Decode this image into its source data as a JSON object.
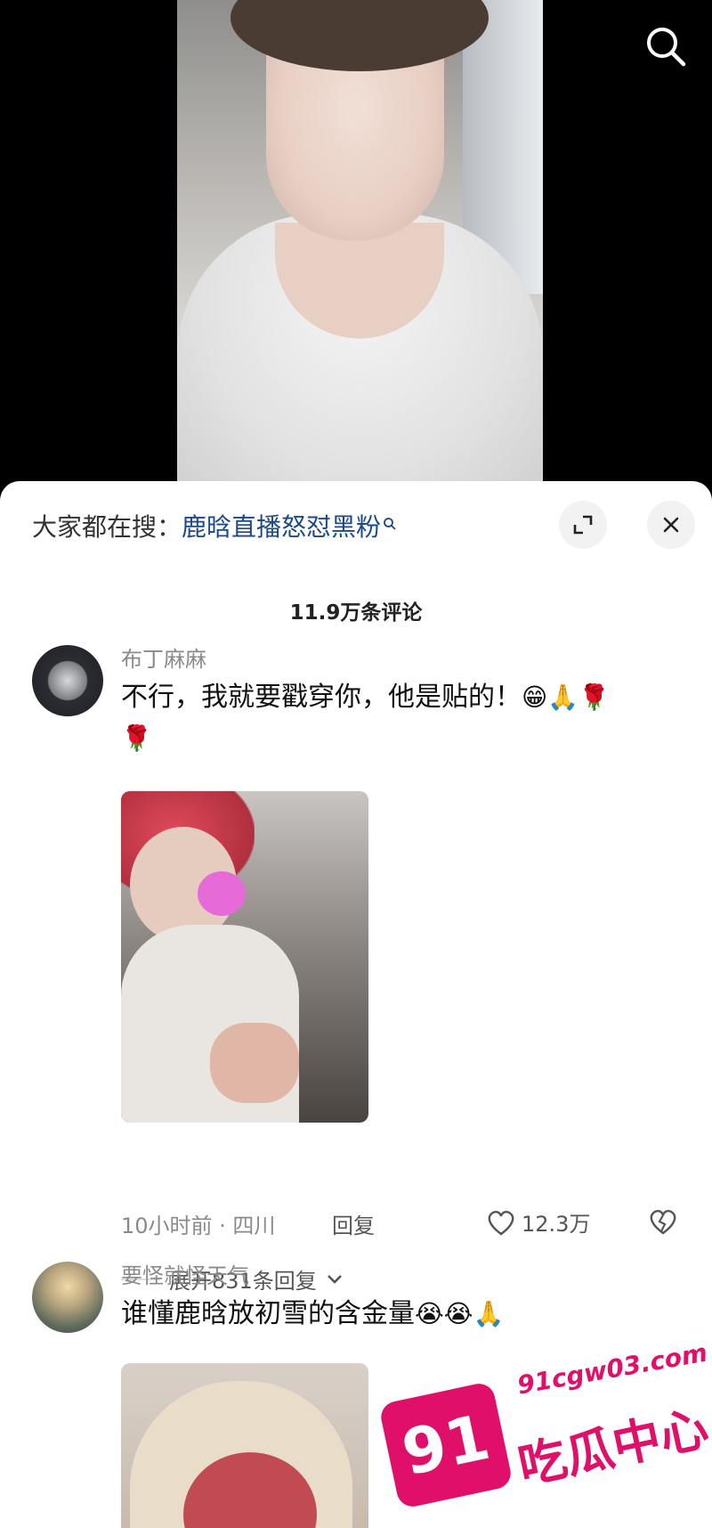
{
  "search_hint": {
    "prefix": "大家都在搜：",
    "keyword": "鹿晗直播怒怼黑粉"
  },
  "comments_count": "11.9万条评论",
  "comments": [
    {
      "username": "布丁麻麻",
      "text": "不行，我就要戳穿你，他是贴的！",
      "emojis": [
        "😁",
        "🙏",
        "🌹",
        "🌹"
      ],
      "time_location": "10小时前 · 四川",
      "reply_label": "回复",
      "likes": "12.3万",
      "expand_label": "展开831条回复"
    },
    {
      "username": "要怪就怪天气",
      "text": "谁懂鹿晗放初雪的含金量",
      "emojis": [
        "😭",
        "😭",
        "🙏"
      ]
    }
  ],
  "watermark": {
    "number": "91",
    "url": "91cgw03.com",
    "name": "吃瓜中心"
  },
  "colors": {
    "keyword": "#1a4a8c",
    "watermark": "#e0106a"
  }
}
